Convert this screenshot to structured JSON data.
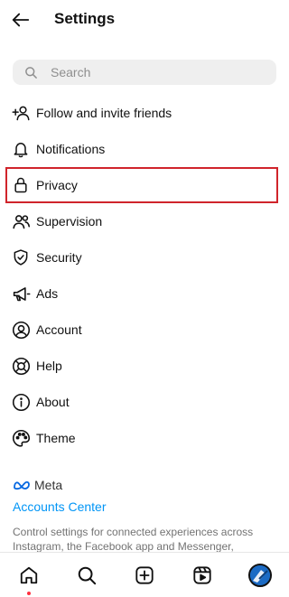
{
  "header": {
    "title": "Settings",
    "back_icon": "arrow-left-icon"
  },
  "search": {
    "placeholder": "Search"
  },
  "menu": {
    "items": [
      {
        "label": "Follow and invite friends",
        "icon": "add-person-icon"
      },
      {
        "label": "Notifications",
        "icon": "bell-icon"
      },
      {
        "label": "Privacy",
        "icon": "lock-icon",
        "highlighted": true
      },
      {
        "label": "Supervision",
        "icon": "people-icon"
      },
      {
        "label": "Security",
        "icon": "shield-icon"
      },
      {
        "label": "Ads",
        "icon": "megaphone-icon"
      },
      {
        "label": "Account",
        "icon": "account-circle-icon"
      },
      {
        "label": "Help",
        "icon": "lifebuoy-icon"
      },
      {
        "label": "About",
        "icon": "info-icon"
      },
      {
        "label": "Theme",
        "icon": "palette-icon"
      }
    ]
  },
  "meta": {
    "logo_text": "Meta",
    "accounts_center": "Accounts Center",
    "description": "Control settings for connected experiences across Instagram, the Facebook app and Messenger, including"
  },
  "bottom_nav": {
    "items": [
      "home-icon",
      "search-icon",
      "create-icon",
      "reels-icon",
      "profile-avatar"
    ]
  },
  "colors": {
    "highlight": "#d0242b",
    "link": "#0095f6",
    "search_bg": "#efefef",
    "notification_dot": "#ff3040"
  }
}
